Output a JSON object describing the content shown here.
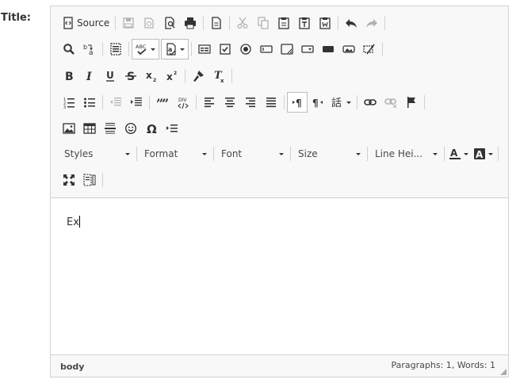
{
  "field": {
    "label": "Title:"
  },
  "toolbar": {
    "source_label": "Source",
    "styles_label": "Styles",
    "format_label": "Format",
    "font_label": "Font",
    "size_label": "Size",
    "line_height_label": "Line Hei...",
    "icons": [
      "source-icon",
      "save-icon",
      "templates-icon",
      "preview-icon",
      "print-icon",
      "new-page-icon",
      "cut-icon",
      "copy-icon",
      "paste-icon",
      "paste-text-icon",
      "paste-word-icon",
      "undo-icon",
      "redo-icon",
      "find-icon",
      "replace-icon",
      "select-all-icon",
      "spellcheck-icon",
      "scayt-icon",
      "form-icon",
      "checkbox-icon",
      "radio-icon",
      "textfield-icon",
      "textarea-icon",
      "select-field-icon",
      "button-icon",
      "image-button-icon",
      "hidden-field-icon",
      "bold-icon",
      "italic-icon",
      "underline-icon",
      "strike-icon",
      "subscript-icon",
      "superscript-icon",
      "copy-format-icon",
      "remove-format-icon",
      "numbered-list-icon",
      "bulleted-list-icon",
      "outdent-icon",
      "indent-icon",
      "blockquote-icon",
      "div-icon",
      "align-left-icon",
      "align-center-icon",
      "align-right-icon",
      "justify-icon",
      "ltr-icon",
      "rtl-icon",
      "language-icon",
      "link-icon",
      "unlink-icon",
      "anchor-icon",
      "image-icon",
      "table-icon",
      "horizontal-rule-icon",
      "smiley-icon",
      "special-char-icon",
      "page-break-icon",
      "text-color-icon",
      "bg-color-icon",
      "maximize-icon",
      "show-blocks-icon"
    ]
  },
  "content": {
    "text": "Ex"
  },
  "status": {
    "path": "body",
    "counts": "Paragraphs: 1, Words: 1"
  }
}
